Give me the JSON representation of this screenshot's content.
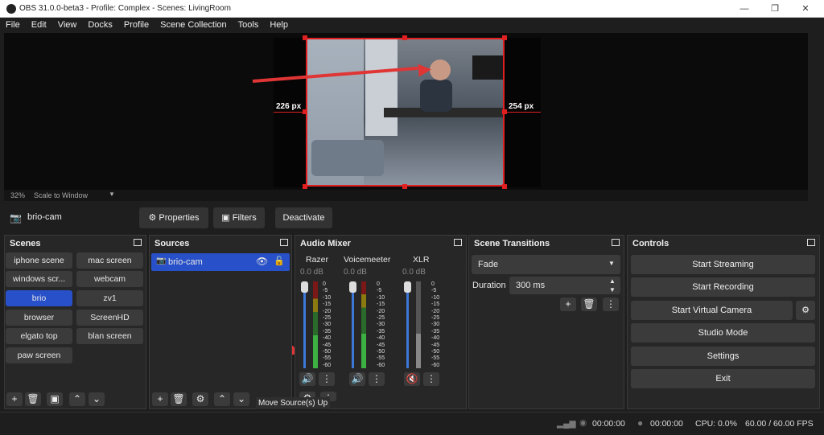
{
  "window": {
    "title": "OBS 31.0.0-beta3 - Profile: Complex - Scenes: LivingRoom",
    "minimize": "—",
    "maximize": "❐",
    "close": "✕"
  },
  "menu": [
    "File",
    "Edit",
    "View",
    "Docks",
    "Profile",
    "Scene Collection",
    "Tools",
    "Help"
  ],
  "preview": {
    "left_px": "226 px",
    "right_px": "254 px",
    "zoom": "32%",
    "scale_mode": "Scale to Window"
  },
  "source_bar": {
    "name": "brio-cam",
    "properties": "Properties",
    "filters": "Filters",
    "deactivate": "Deactivate"
  },
  "scenes": {
    "title": "Scenes",
    "items": [
      "iphone scene",
      "mac screen",
      "windows scr...",
      "webcam",
      "brio",
      "zv1",
      "browser",
      "ScreenHD",
      "elgato top",
      "blan screen",
      "paw screen"
    ],
    "selected": "brio"
  },
  "sources": {
    "title": "Sources",
    "items": [
      {
        "name": "brio-cam"
      }
    ]
  },
  "audio_mixer": {
    "title": "Audio Mixer",
    "channels": [
      {
        "name": "Razer",
        "db": "0.0 dB",
        "muted": false
      },
      {
        "name": "Voicemeeter",
        "db": "0.0 dB",
        "muted": false
      },
      {
        "name": "XLR",
        "db": "0.0 dB",
        "muted": true
      }
    ],
    "scale": [
      "0",
      "-5",
      "-10",
      "-15",
      "-20",
      "-25",
      "-30",
      "-35",
      "-40",
      "-45",
      "-50",
      "-55",
      "-60"
    ]
  },
  "transitions": {
    "title": "Scene Transitions",
    "selected": "Fade",
    "duration_label": "Duration",
    "duration": "300 ms"
  },
  "controls": {
    "title": "Controls",
    "buttons": [
      "Start Streaming",
      "Start Recording",
      "Start Virtual Camera",
      "Studio Mode",
      "Settings",
      "Exit"
    ]
  },
  "tooltip": "Move Source(s) Up",
  "status": {
    "stream_time": "00:00:00",
    "rec_time": "00:00:00",
    "cpu": "CPU: 0.0%",
    "fps": "60.00 / 60.00 FPS"
  },
  "colors": {
    "accent": "#2850c8",
    "annotation": "#e03535",
    "meter_green": "#3cb043",
    "meter_yellow": "#c8b400",
    "meter_red": "#c02020"
  }
}
